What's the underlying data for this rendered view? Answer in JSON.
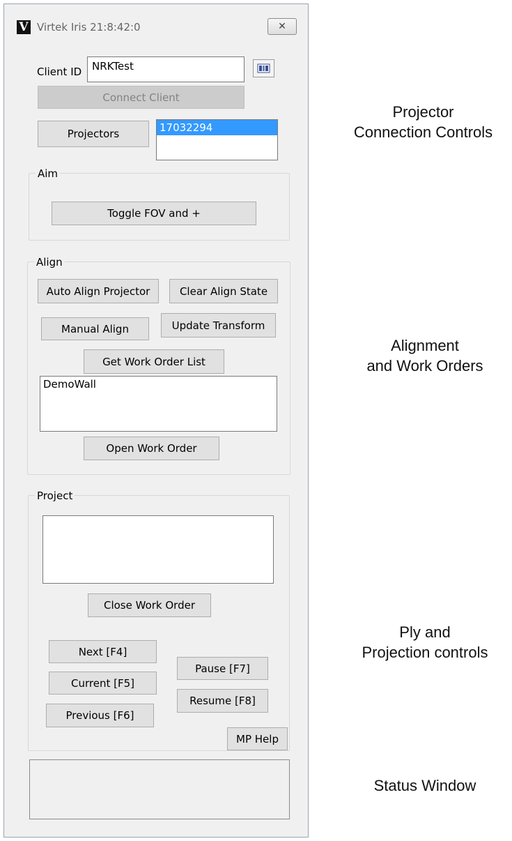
{
  "window": {
    "title": "Virtek Iris 21:8:42:0",
    "logo_letter": "V",
    "close_glyph": "✕"
  },
  "connection": {
    "client_id_label": "Client ID",
    "client_id_value": "NRKTest",
    "connect_label": "Connect Client",
    "projectors_label": "Projectors",
    "projector_items": [
      "17032294"
    ]
  },
  "aim": {
    "legend": "Aim",
    "toggle_label": "Toggle FOV and +"
  },
  "align": {
    "legend": "Align",
    "auto_align_label": "Auto Align Projector",
    "clear_align_label": "Clear Align State",
    "manual_align_label": "Manual Align",
    "update_transform_label": "Update Transform",
    "get_work_orders_label": "Get Work Order List",
    "work_orders": [
      "DemoWall"
    ],
    "open_work_order_label": "Open Work Order"
  },
  "project": {
    "legend": "Project",
    "close_work_order_label": "Close Work Order",
    "next_label": "Next [F4]",
    "current_label": "Current [F5]",
    "previous_label": "Previous [F6]",
    "pause_label": "Pause [F7]",
    "resume_label": "Resume [F8]",
    "help_label": "MP Help"
  },
  "annotations": {
    "connection_line1": "Projector",
    "connection_line2": "Connection Controls",
    "alignment_line1": "Alignment",
    "alignment_line2": "and Work Orders",
    "ply_line1": "Ply and",
    "ply_line2": "Projection controls",
    "status": "Status Window"
  }
}
